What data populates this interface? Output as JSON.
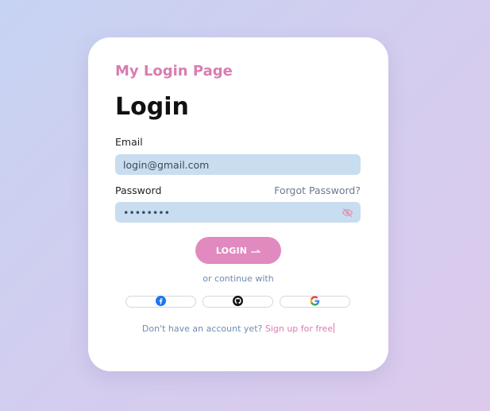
{
  "brand": {
    "title": "My Login Page"
  },
  "form": {
    "heading": "Login",
    "email_label": "Email",
    "email_value": "login@gmail.com",
    "password_label": "Password",
    "password_value": "••••••••",
    "forgot_label": "Forgot Password?",
    "login_button": "LOGIN",
    "login_arrow_icon": "arrow-right-icon",
    "eye_icon": "eye-icon"
  },
  "social": {
    "continue_text": "or continue with",
    "providers": [
      {
        "icon": "facebook-icon",
        "color": "#1877f2"
      },
      {
        "icon": "github-icon",
        "color": "#111111"
      },
      {
        "icon": "google-icon",
        "color": "#4285f4"
      }
    ]
  },
  "signup": {
    "question": "Don't have an account yet?",
    "link": "Sign up for free"
  },
  "colors": {
    "accent_pink": "#e18ac0",
    "brand_pink": "#d97db1",
    "field_bg": "#c9ddf0",
    "muted_blue": "#6f8bb0"
  }
}
